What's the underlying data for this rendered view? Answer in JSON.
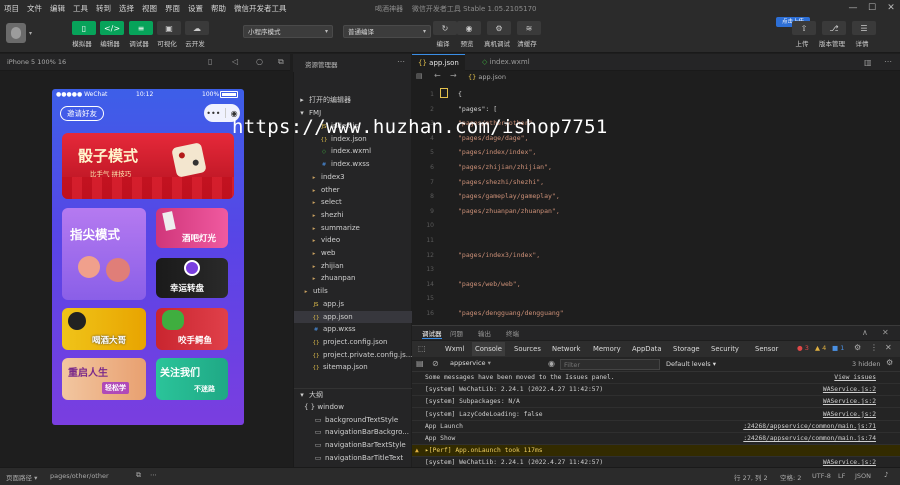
{
  "menu": [
    "项目",
    "文件",
    "编辑",
    "工具",
    "转到",
    "选择",
    "视图",
    "界面",
    "设置",
    "帮助",
    "微信开发者工具"
  ],
  "app_title": "喝酒神器",
  "app_version": "微信开发者工具 Stable 1.05.2105170",
  "toolbar": {
    "left_buttons": [
      {
        "label": "模拟器",
        "icon": "phone-icon"
      },
      {
        "label": "编辑器",
        "icon": "code-icon"
      },
      {
        "label": "调试器",
        "icon": "debug-icon"
      },
      {
        "label": "可视化",
        "icon": "visual-icon"
      },
      {
        "label": "云开发",
        "icon": "cloud-icon"
      }
    ],
    "mode_select": "小程序模式",
    "compile_select": "普通编译",
    "mid_buttons": [
      {
        "label": "编译",
        "icon": "refresh-icon"
      },
      {
        "label": "预览",
        "icon": "eye-icon"
      },
      {
        "label": "真机调试",
        "icon": "gear-icon"
      },
      {
        "label": "清缓存",
        "icon": "layers-icon"
      }
    ],
    "right_buttons": [
      {
        "label": "上传",
        "icon": "upload-icon"
      },
      {
        "label": "版本管理",
        "icon": "branch-icon"
      },
      {
        "label": "详情",
        "icon": "details-icon"
      }
    ],
    "upload_tag": "点击上传"
  },
  "simulator": {
    "device": "iPhone 5 100% 16",
    "status_left": "●●●●● WeChat",
    "status_time": "10:12",
    "status_battery": "100%",
    "invite_label": "邀请好友",
    "cards": {
      "dice": {
        "title": "骰子模式",
        "sub": "比手气  拼技巧"
      },
      "finger": {
        "title": "指尖模式"
      },
      "bar": {
        "title": "酒吧灯光"
      },
      "wheel": {
        "title": "幸运转盘"
      },
      "king": {
        "title": "喝酒大哥"
      },
      "croc": {
        "title": "咬手鳄鱼"
      },
      "restart": {
        "title": "重启人生",
        "sub": "轻松学"
      },
      "follow": {
        "title": "关注我们",
        "sub": "不迷路"
      }
    }
  },
  "explorer": {
    "open_editors": "打开的编辑器",
    "project": "FMJ",
    "rows": [
      {
        "label": "index.js",
        "icon": "js-icon",
        "indent": 26
      },
      {
        "label": "index.json",
        "icon": "json-icon",
        "indent": 26
      },
      {
        "label": "index.wxml",
        "icon": "wxml-icon",
        "indent": 26
      },
      {
        "label": "index.wxss",
        "icon": "wxss-icon",
        "indent": 26
      },
      {
        "label": "index3",
        "icon": "folder-icon",
        "indent": 16
      },
      {
        "label": "other",
        "icon": "folder-icon",
        "indent": 16
      },
      {
        "label": "select",
        "icon": "folder-icon",
        "indent": 16
      },
      {
        "label": "shezhi",
        "icon": "folder-icon",
        "indent": 16
      },
      {
        "label": "summarize",
        "icon": "folder-icon",
        "indent": 16
      },
      {
        "label": "video",
        "icon": "folder-icon",
        "indent": 16
      },
      {
        "label": "web",
        "icon": "folder-icon",
        "indent": 16
      },
      {
        "label": "zhijian",
        "icon": "folder-icon",
        "indent": 16
      },
      {
        "label": "zhuanpan",
        "icon": "folder-icon",
        "indent": 16
      },
      {
        "label": "utils",
        "icon": "folder-icon",
        "indent": 8
      },
      {
        "label": "app.js",
        "icon": "js-icon",
        "indent": 18
      },
      {
        "label": "app.json",
        "icon": "json-icon",
        "indent": 18
      },
      {
        "label": "app.wxss",
        "icon": "wxss-icon",
        "indent": 18
      },
      {
        "label": "project.config.json",
        "icon": "json-icon",
        "indent": 18
      },
      {
        "label": "project.private.config.js...",
        "icon": "json-icon",
        "indent": 18
      },
      {
        "label": "sitemap.json",
        "icon": "json-icon",
        "indent": 18
      }
    ],
    "outline": "大纲",
    "outline_rows": [
      {
        "label": "{ } window",
        "indent": 10
      },
      {
        "label": "backgroundTextStyle",
        "indent": 20
      },
      {
        "label": "navigationBarBackgro...",
        "indent": 20
      },
      {
        "label": "navigationBarTextStyle",
        "indent": 20
      },
      {
        "label": "navigationBarTitleText",
        "indent": 20
      }
    ]
  },
  "editor": {
    "tabs": [
      "app.json",
      "index.wxml"
    ],
    "breadcrumb": "app.json",
    "lines": [
      {
        "n": "1",
        "text": "{",
        "str": false
      },
      {
        "n": "2",
        "text": "  \"pages\": [",
        "str": false
      },
      {
        "n": "3",
        "text": "    \"pages/other/other\",",
        "str": true
      },
      {
        "n": "4",
        "text": "    \"pages/dage/dage\",",
        "str": true
      },
      {
        "n": "5",
        "text": "    \"pages/index/index\",",
        "str": true
      },
      {
        "n": "6",
        "text": "    \"pages/zhijian/zhijian\",",
        "str": true
      },
      {
        "n": "7",
        "text": "    \"pages/shezhi/shezhi\",",
        "str": true
      },
      {
        "n": "8",
        "text": "    \"pages/gameplay/gameplay\",",
        "str": true
      },
      {
        "n": "9",
        "text": "    \"pages/zhuanpan/zhuanpan\",",
        "str": true
      },
      {
        "n": "10",
        "text": "",
        "str": false
      },
      {
        "n": "11",
        "text": "",
        "str": false
      },
      {
        "n": "12",
        "text": "    \"pages/index3/index\",",
        "str": true
      },
      {
        "n": "13",
        "text": "",
        "str": false
      },
      {
        "n": "14",
        "text": "    \"pages/web/web\",",
        "str": true
      },
      {
        "n": "15",
        "text": "",
        "str": false
      },
      {
        "n": "16",
        "text": "    \"pages/dengguang/dengguang\"",
        "str": true
      }
    ]
  },
  "panel_tabs": [
    "调试器",
    "问题",
    "输出",
    "终端"
  ],
  "console_tabs": [
    "Wxml",
    "Console",
    "Sources",
    "Network",
    "Memory",
    "AppData",
    "Storage",
    "Security",
    "Sensor"
  ],
  "console_counts": {
    "errors": "3",
    "warnings": "4",
    "info": "1"
  },
  "console_filter": {
    "context": "appservice",
    "placeholder": "Filter",
    "levels": "Default levels",
    "hidden": "3 hidden"
  },
  "console_rows": [
    {
      "msg": "Some messages have been moved to the Issues panel.",
      "src": "View issues",
      "warn": false
    },
    {
      "msg": "[system] WeChatLib: 2.24.1 (2022.4.27 11:42:57)",
      "src": "WAService.js:2",
      "warn": false
    },
    {
      "msg": "[system] Subpackages: N/A",
      "src": "WAService.js:2",
      "warn": false
    },
    {
      "msg": "[system] LazyCodeLoading: false",
      "src": "WAService.js:2",
      "warn": false
    },
    {
      "msg": "App Launch",
      "src": ":24268/appservice/common/main.js:71",
      "warn": false
    },
    {
      "msg": "App Show",
      "src": ":24268/appservice/common/main.js:74",
      "warn": false
    },
    {
      "msg": "▸[Perf] App.onLaunch took 117ms",
      "src": "",
      "warn": true
    },
    {
      "msg": "[system] WeChatLib: 2.24.1 (2022.4.27 11:42:57)",
      "src": "WAService.js:2",
      "warn": false
    }
  ],
  "statusbar": {
    "path_label": "页面路径",
    "path": "pages/other/other",
    "position": "行 27, 列 2",
    "spaces": "空格: 2",
    "encoding": "UTF-8",
    "eol": "LF",
    "lang": "JSON"
  },
  "watermark": "https://www.huzhan.com/ishop7751"
}
